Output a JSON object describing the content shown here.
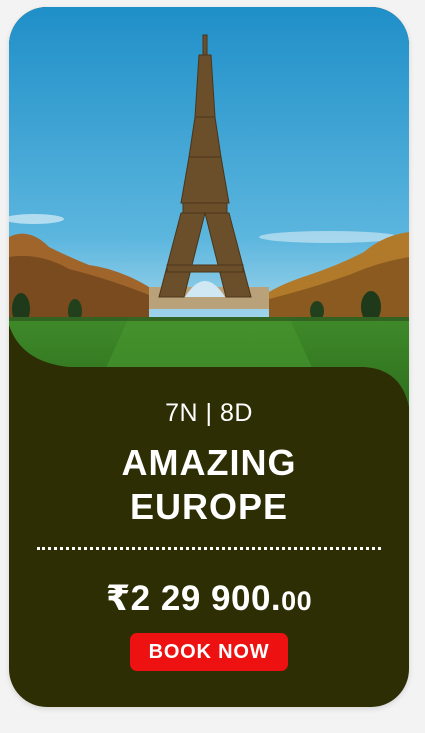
{
  "package": {
    "duration": "7N | 8D",
    "title_line1": "AMAZING",
    "title_line2": "EUROPE",
    "price_main": "₹2 29 900.",
    "price_cents": "00",
    "cta_label": "BOOK NOW"
  },
  "colors": {
    "card_bg": "#2e2e05",
    "cta_bg": "#ee1111",
    "text": "#ffffff"
  },
  "image": {
    "icon": "eiffel-tower-photo"
  }
}
